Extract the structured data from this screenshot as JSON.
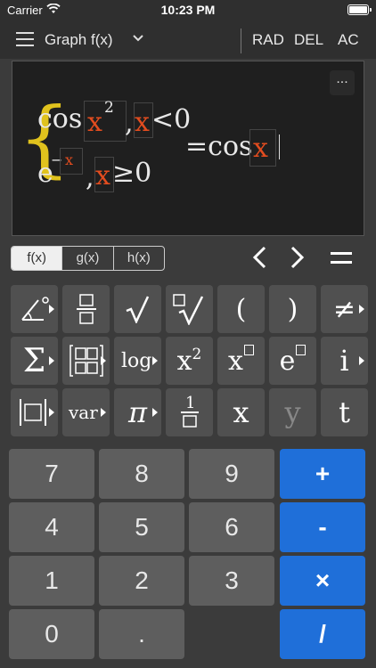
{
  "status_bar": {
    "carrier": "Carrier",
    "time": "10:23 PM"
  },
  "toolbar": {
    "mode_title": "Graph f(x)",
    "rad_label": "RAD",
    "del_label": "DEL",
    "ac_label": "AC"
  },
  "display": {
    "expression": {
      "piece1_func": "cos",
      "piece1_arg": "x",
      "piece1_exp": "2",
      "piece1_cond_var": "x",
      "piece1_cond": "<0",
      "piece2_base": "e",
      "piece2_exp_sign": "−",
      "piece2_exp_var": "x",
      "piece2_cond_var": "x",
      "piece2_cond": "≥0",
      "comma": ",",
      "rhs_eq": "=cos",
      "rhs_arg": "x"
    },
    "more_label": "..."
  },
  "tabs": [
    {
      "label": "f(x)",
      "active": true
    },
    {
      "label": "g(x)",
      "active": false
    },
    {
      "label": "h(x)",
      "active": false
    }
  ],
  "function_keys": {
    "row1": [
      "∠°",
      "□/□",
      "√",
      "□√",
      "(",
      ")",
      "≠"
    ],
    "row2": [
      "Σ",
      "[□□]",
      "log",
      "x²",
      "x□",
      "e□",
      "i"
    ],
    "row3": [
      "|□|",
      "var",
      "π",
      "1/□",
      "x",
      "y",
      "t"
    ],
    "log_label": "log",
    "var_label": "var",
    "frac_one": "1"
  },
  "number_keys": [
    [
      "7",
      "8",
      "9",
      "+"
    ],
    [
      "4",
      "5",
      "6",
      "-"
    ],
    [
      "1",
      "2",
      "3",
      "×"
    ],
    [
      "0",
      ".",
      "",
      "/"
    ]
  ],
  "colors": {
    "accent_blue": "#1f6fd9",
    "brace_yellow": "#e0c21d",
    "var_red": "#e24c1f"
  }
}
